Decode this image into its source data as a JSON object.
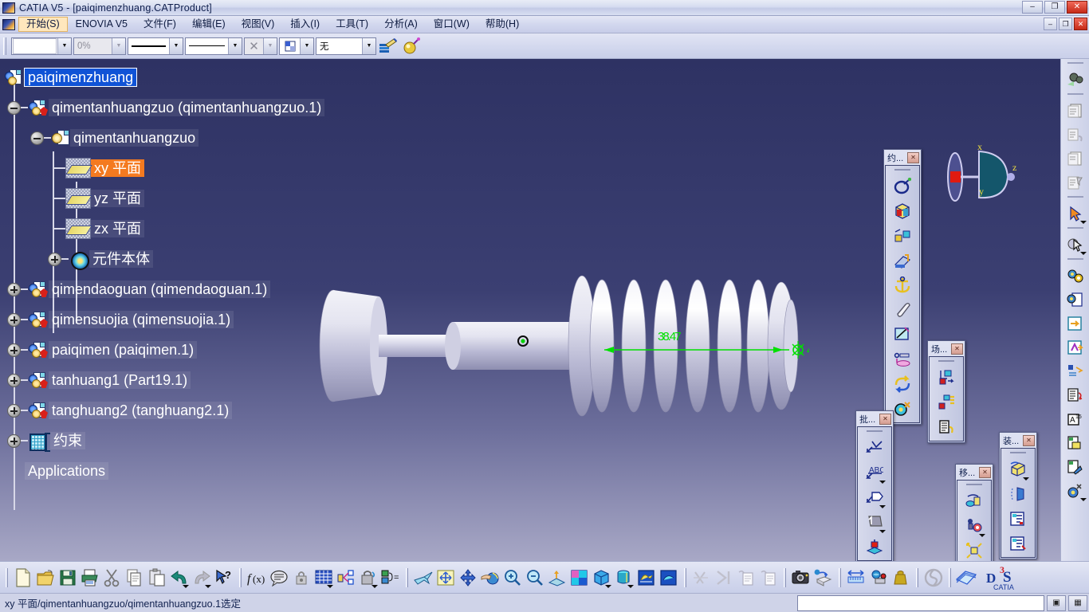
{
  "window": {
    "title": "CATIA V5 - [paiqimenzhuang.CATProduct]",
    "app_icon": "catia-logo-icon",
    "buttons": {
      "minimize": "–",
      "maximize": "❐",
      "close": "✕"
    }
  },
  "menubar": {
    "logo_icon": "catia-logo-icon",
    "items": [
      {
        "label": "开始(S)",
        "name": "menu-start",
        "active": true
      },
      {
        "label": "ENOVIA V5",
        "name": "menu-enovia",
        "active": false
      },
      {
        "label": "文件(F)",
        "name": "menu-file",
        "active": false
      },
      {
        "label": "编辑(E)",
        "name": "menu-edit",
        "active": false
      },
      {
        "label": "视图(V)",
        "name": "menu-view",
        "active": false
      },
      {
        "label": "插入(I)",
        "name": "menu-insert",
        "active": false
      },
      {
        "label": "工具(T)",
        "name": "menu-tools",
        "active": false
      },
      {
        "label": "分析(A)",
        "name": "menu-analyze",
        "active": false
      },
      {
        "label": "窗口(W)",
        "name": "menu-window",
        "active": false
      },
      {
        "label": "帮助(H)",
        "name": "menu-help",
        "active": false
      }
    ],
    "doc_buttons": {
      "minimize": "–",
      "restore": "❐",
      "close": "✕"
    }
  },
  "graphic_toolbar": {
    "fill_color": {
      "value": "",
      "name": "fill-color-combo"
    },
    "transparency": {
      "value": "0%",
      "name": "transparency-combo",
      "disabled": true
    },
    "line_thickness": {
      "value": "line-thick",
      "name": "line-thickness-combo"
    },
    "line_type": {
      "value": "line-solid",
      "name": "line-type-combo"
    },
    "point_symbol": {
      "value": "✕",
      "name": "point-symbol-combo",
      "disabled": true
    },
    "render_style": {
      "value": "render-icon",
      "name": "render-style-combo"
    },
    "layer": {
      "value": "无",
      "name": "layer-combo"
    },
    "painter_icon": "format-painter-icon",
    "material_icon": "apply-material-icon"
  },
  "tree": {
    "nodes": [
      {
        "label": "paiqimenzhuang",
        "name": "tree-node-paiqimenzhuang",
        "icon": "product-icon",
        "state": "selected-blue",
        "depth": 0,
        "expander": "none"
      },
      {
        "label": "qimentanhuangzuo (qimentanhuangzuo.1)",
        "name": "tree-node-qimentanhuangzuo-instance",
        "icon": "part-icon",
        "state": "normal",
        "depth": 1,
        "expander": "minus"
      },
      {
        "label": "qimentanhuangzuo",
        "name": "tree-node-qimentanhuangzuo-part",
        "icon": "partbody-icon",
        "state": "normal",
        "depth": 2,
        "expander": "minus"
      },
      {
        "label": "xy 平面",
        "name": "tree-node-xy-plane",
        "icon": "plane-icon",
        "state": "selected-orange",
        "depth": 3,
        "expander": "none"
      },
      {
        "label": "yz 平面",
        "name": "tree-node-yz-plane",
        "icon": "plane-icon",
        "state": "normal",
        "depth": 3,
        "expander": "none"
      },
      {
        "label": "zx 平面",
        "name": "tree-node-zx-plane",
        "icon": "plane-icon",
        "state": "normal",
        "depth": 3,
        "expander": "none"
      },
      {
        "label": "元件本体",
        "name": "tree-node-partbody",
        "icon": "body-icon",
        "state": "normal",
        "depth": 3,
        "expander": "plus"
      },
      {
        "label": "qimendaoguan (qimendaoguan.1)",
        "name": "tree-node-qimendaoguan",
        "icon": "part-icon",
        "state": "normal",
        "depth": 1,
        "expander": "plus"
      },
      {
        "label": "qimensuojia (qimensuojia.1)",
        "name": "tree-node-qimensuojia",
        "icon": "part-icon",
        "state": "normal",
        "depth": 1,
        "expander": "plus"
      },
      {
        "label": "paiqimen (paiqimen.1)",
        "name": "tree-node-paiqimen",
        "icon": "part-icon",
        "state": "normal",
        "depth": 1,
        "expander": "plus"
      },
      {
        "label": "tanhuang1 (Part19.1)",
        "name": "tree-node-tanhuang1",
        "icon": "part-icon",
        "state": "normal",
        "depth": 1,
        "expander": "plus"
      },
      {
        "label": "tanghuang2 (tanghuang2.1)",
        "name": "tree-node-tanghuang2",
        "icon": "part-icon",
        "state": "normal",
        "depth": 1,
        "expander": "plus"
      },
      {
        "label": "约束",
        "name": "tree-node-constraints",
        "icon": "constraint-icon",
        "state": "normal",
        "depth": 1,
        "expander": "plus"
      },
      {
        "label": "Applications",
        "name": "tree-node-applications",
        "icon": "none",
        "state": "normal",
        "depth": 1,
        "expander": "none"
      }
    ]
  },
  "viewport": {
    "dimension_label": "38.47",
    "dimension_color": "#00e000",
    "compass_labels": {
      "x": "x",
      "y": "y",
      "z": "z"
    },
    "axis_labels": {
      "x": "x",
      "y": "y",
      "z": "z"
    }
  },
  "palettes": [
    {
      "name": "palette-constraints",
      "title": "约...",
      "close_label": "✕",
      "buttons": [
        {
          "name": "constraint-coincidence-icon",
          "glyph": "coincidence"
        },
        {
          "name": "constraint-contact-icon",
          "glyph": "contact"
        },
        {
          "name": "constraint-offset-icon",
          "glyph": "offset"
        },
        {
          "name": "constraint-angle-icon",
          "glyph": "angle"
        },
        {
          "name": "constraint-fix-icon",
          "glyph": "anchor"
        },
        {
          "name": "constraint-fix-together-icon",
          "glyph": "clip"
        },
        {
          "name": "constraint-quick-icon",
          "glyph": "quick"
        },
        {
          "name": "constraint-change-icon",
          "glyph": "change"
        },
        {
          "name": "constraint-reuse-pattern-icon",
          "glyph": "reuse"
        },
        {
          "name": "constraint-flexible-rigid-icon",
          "glyph": "flexrigid"
        }
      ]
    },
    {
      "name": "palette-scene",
      "title": "场...",
      "close_label": "✕",
      "buttons": [
        {
          "name": "scene-create-icon",
          "glyph": "scene-create"
        },
        {
          "name": "scene-enhanced-icon",
          "glyph": "scene-enhanced"
        },
        {
          "name": "scene-browser-icon",
          "glyph": "scene-browser"
        }
      ]
    },
    {
      "name": "palette-annotations",
      "title": "批...",
      "close_label": "✕",
      "buttons": [
        {
          "name": "annotation-weld-icon",
          "glyph": "weld"
        },
        {
          "name": "annotation-text-icon",
          "glyph": "abc"
        },
        {
          "name": "annotation-flag-note-icon",
          "glyph": "flagnote"
        },
        {
          "name": "annotation-picture-icon",
          "glyph": "picture"
        },
        {
          "name": "annotation-view-icon",
          "glyph": "annotview"
        }
      ]
    },
    {
      "name": "palette-move",
      "title": "移...",
      "close_label": "✕",
      "buttons": [
        {
          "name": "move-manipulation-icon",
          "glyph": "manipulate"
        },
        {
          "name": "move-snap-icon",
          "glyph": "snap"
        },
        {
          "name": "move-explode-icon",
          "glyph": "explode"
        },
        {
          "name": "move-clash-icon",
          "glyph": "clash"
        }
      ]
    },
    {
      "name": "palette-assembly",
      "title": "装...",
      "close_label": "✕",
      "buttons": [
        {
          "name": "assembly-new-part-icon",
          "glyph": "newpart"
        },
        {
          "name": "assembly-existing-component-icon",
          "glyph": "existing"
        },
        {
          "name": "assembly-replace-component-icon",
          "glyph": "replace"
        },
        {
          "name": "assembly-graph-tree-reorder-icon",
          "glyph": "reorder"
        }
      ]
    }
  ],
  "right_toolbar": {
    "buttons": [
      {
        "name": "update-all-icon",
        "glyph": "update"
      },
      {
        "name": "catalog-browser-icon",
        "glyph": "catalog1"
      },
      {
        "name": "catalog-replace-icon",
        "glyph": "catalog2"
      },
      {
        "name": "catalog-paste-icon",
        "glyph": "catalog3"
      },
      {
        "name": "catalog-filter-icon",
        "glyph": "catalog4"
      },
      {
        "name": "select-arrow-icon",
        "glyph": "arrow"
      },
      {
        "name": "select-trap-icon",
        "glyph": "traparrow"
      },
      {
        "name": "product-structure-icon",
        "glyph": "gears"
      },
      {
        "name": "new-part-doc-icon",
        "glyph": "newpartdoc"
      },
      {
        "name": "export-icon",
        "glyph": "export"
      },
      {
        "name": "publish-icon",
        "glyph": "publish"
      },
      {
        "name": "bom-icon",
        "glyph": "bom"
      },
      {
        "name": "reorder-tree-icon",
        "glyph": "reordertree"
      },
      {
        "name": "numbering-icon",
        "glyph": "numbering"
      },
      {
        "name": "selective-load-icon",
        "glyph": "selective"
      },
      {
        "name": "manage-representation-icon",
        "glyph": "managerep"
      },
      {
        "name": "flexible-rigid-sub-icon",
        "glyph": "flexsub"
      }
    ]
  },
  "bottom_toolbar": {
    "groups": [
      {
        "name": "standard-group",
        "buttons": [
          {
            "name": "new-document-icon",
            "glyph": "new"
          },
          {
            "name": "open-document-icon",
            "glyph": "open"
          },
          {
            "name": "save-document-icon",
            "glyph": "save"
          },
          {
            "name": "print-icon",
            "glyph": "print"
          },
          {
            "name": "cut-icon",
            "glyph": "cut"
          },
          {
            "name": "copy-icon",
            "glyph": "copy"
          },
          {
            "name": "paste-icon",
            "glyph": "paste"
          },
          {
            "name": "undo-icon",
            "glyph": "undo",
            "arrow": true
          },
          {
            "name": "redo-icon",
            "glyph": "redo",
            "arrow": true
          },
          {
            "name": "whats-this-help-icon",
            "glyph": "help"
          }
        ]
      },
      {
        "name": "knowledge-group",
        "buttons": [
          {
            "name": "formula-icon",
            "glyph": "fx"
          },
          {
            "name": "comment-icon",
            "glyph": "comment"
          },
          {
            "name": "lock-icon",
            "glyph": "lock"
          },
          {
            "name": "design-table-icon",
            "glyph": "table",
            "arrow": true
          },
          {
            "name": "parameter-icon",
            "glyph": "param"
          },
          {
            "name": "lock-param-icon",
            "glyph": "lockparam",
            "arrow": true
          },
          {
            "name": "equivalent-dimension-icon",
            "glyph": "equivdim"
          }
        ]
      },
      {
        "name": "view-group",
        "buttons": [
          {
            "name": "fly-mode-icon",
            "glyph": "fly"
          },
          {
            "name": "fit-all-in-icon",
            "glyph": "fitall"
          },
          {
            "name": "pan-icon",
            "glyph": "pan"
          },
          {
            "name": "rotate-icon",
            "glyph": "rotate"
          },
          {
            "name": "zoom-in-icon",
            "glyph": "zoomin"
          },
          {
            "name": "zoom-out-icon",
            "glyph": "zoomout"
          },
          {
            "name": "normal-view-icon",
            "glyph": "normalview"
          },
          {
            "name": "quick-view-icon",
            "glyph": "quickview",
            "arrow": false
          },
          {
            "name": "isometric-view-icon",
            "glyph": "isoview",
            "arrow": true
          },
          {
            "name": "shading-mode-icon",
            "glyph": "shading",
            "arrow": true
          },
          {
            "name": "hide-show-icon",
            "glyph": "hideshow"
          },
          {
            "name": "swap-visible-space-icon",
            "glyph": "swapspace"
          }
        ]
      },
      {
        "name": "measure-group",
        "buttons": [
          {
            "name": "cut-section-icon",
            "glyph": "cutsection"
          },
          {
            "name": "distance-section-icon",
            "glyph": "distsec"
          },
          {
            "name": "catalog-list-icon",
            "glyph": "cataloglist"
          },
          {
            "name": "catalog-list2-icon",
            "glyph": "cataloglist2"
          }
        ]
      },
      {
        "name": "capture-group",
        "buttons": [
          {
            "name": "camera-capture-icon",
            "glyph": "camera"
          },
          {
            "name": "create-scene-icon",
            "glyph": "createscene"
          }
        ]
      },
      {
        "name": "measure-tools-group",
        "buttons": [
          {
            "name": "measure-between-icon",
            "glyph": "measbetween"
          },
          {
            "name": "measure-item-icon",
            "glyph": "measitem"
          },
          {
            "name": "measure-inertia-icon",
            "glyph": "measinertia"
          }
        ]
      },
      {
        "name": "misc-group",
        "buttons": [
          {
            "name": "enovia-link-icon",
            "glyph": "enovialink"
          }
        ]
      },
      {
        "name": "book-group",
        "buttons": [
          {
            "name": "documentation-icon",
            "glyph": "book"
          }
        ]
      }
    ],
    "brand": {
      "top": "3",
      "mid": "S",
      "bottom": "CATIA"
    }
  },
  "statusbar": {
    "message": "xy 平面/qimentanhuangzuo/qimentanhuangzuo.1选定",
    "command_input_value": "",
    "cell1": "▣",
    "cell2": "▦"
  }
}
